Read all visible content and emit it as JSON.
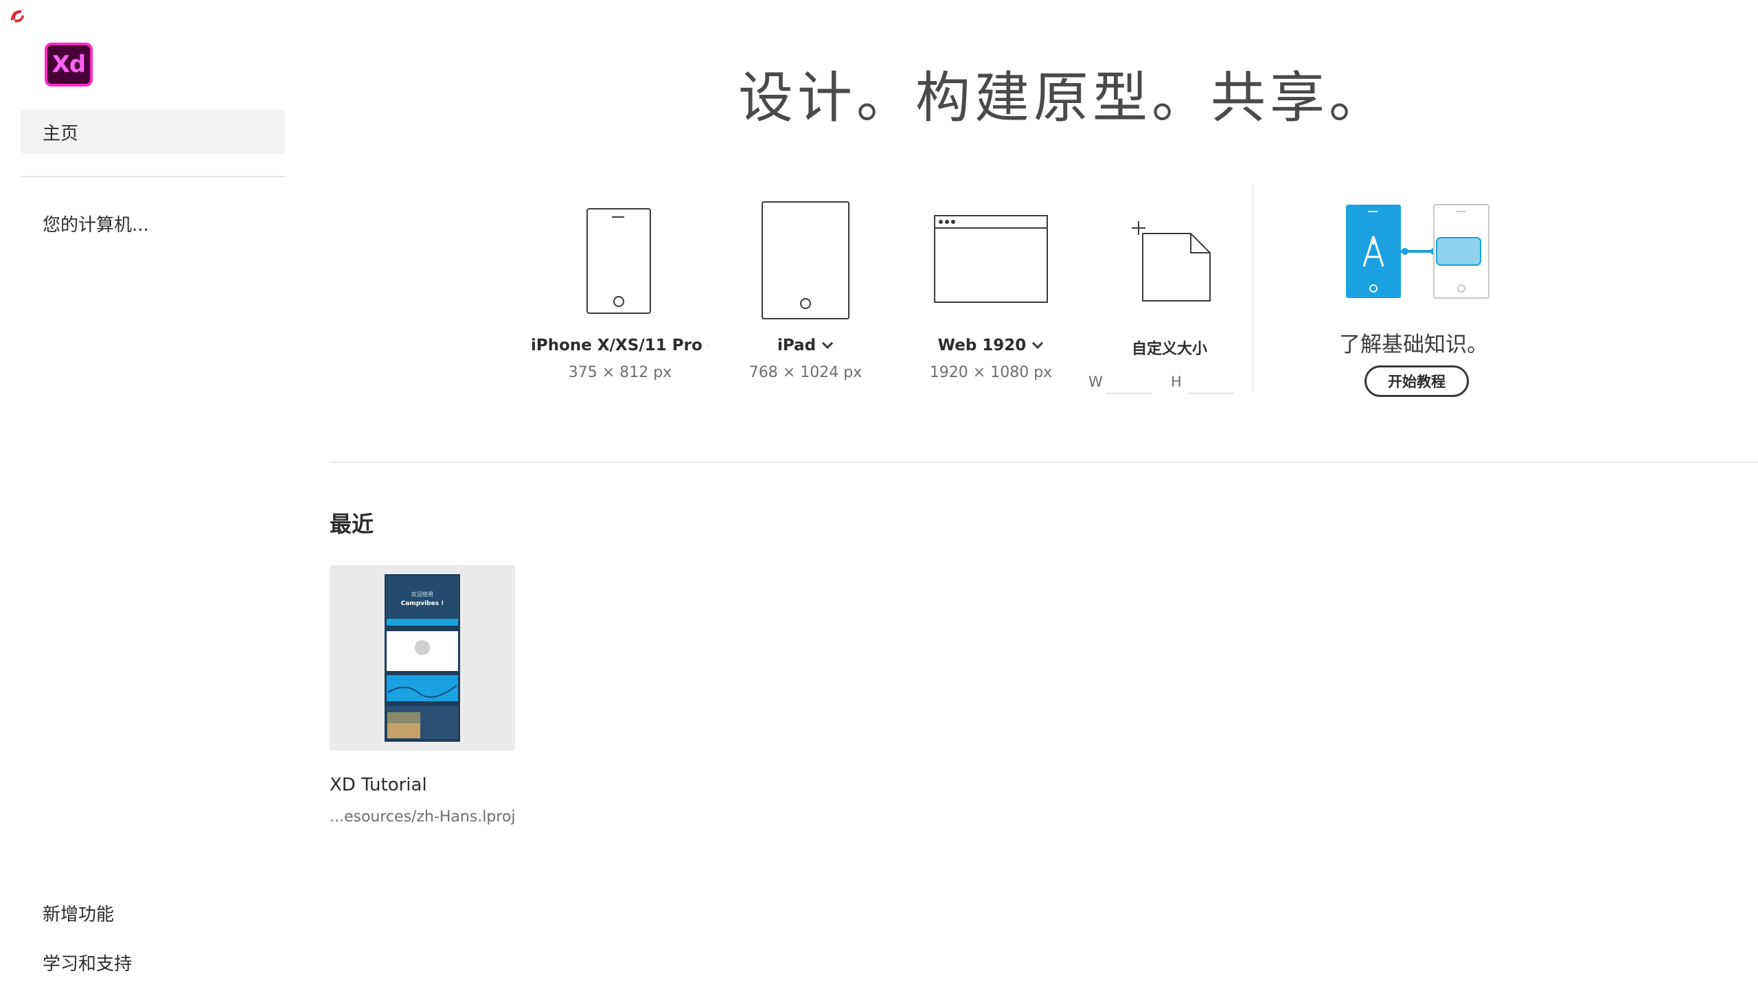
{
  "colors": {
    "xd_bg": "#470137",
    "xd_border": "#ff2bc2",
    "xd_text": "#ff61f6",
    "accent_blue": "#1aa1e0",
    "corner_badge": "#e0262e"
  },
  "app": {
    "logo_text": "Xd",
    "corner_icon": "creative-cloud-badge-icon"
  },
  "sidebar": {
    "home": "主页",
    "computer": "您的计算机...",
    "whats_new": "新增功能",
    "learn_support": "学习和支持"
  },
  "header": {
    "title": "设计。构建原型。共享。"
  },
  "presets": [
    {
      "name": "iPhone X/XS/11 Pro",
      "size": "375 × 812 px",
      "icon": "phone-icon",
      "has_dropdown": true
    },
    {
      "name": "iPad",
      "size": "768 × 1024 px",
      "icon": "tablet-icon",
      "has_dropdown": true
    },
    {
      "name": "Web 1920",
      "size": "1920 × 1080 px",
      "icon": "browser-window-icon",
      "has_dropdown": true
    }
  ],
  "custom": {
    "label": "自定义大小",
    "w_label": "W",
    "h_label": "H",
    "w_value": "",
    "h_value": ""
  },
  "learn": {
    "title": "了解基础知识。",
    "button": "开始教程"
  },
  "recent": {
    "heading": "最近",
    "items": [
      {
        "name": "XD Tutorial",
        "path": "...esources/zh-Hans.lproj",
        "thumb_text": {
          "welcome": "欢迎使用",
          "app": "Campvibes !"
        }
      }
    ]
  }
}
